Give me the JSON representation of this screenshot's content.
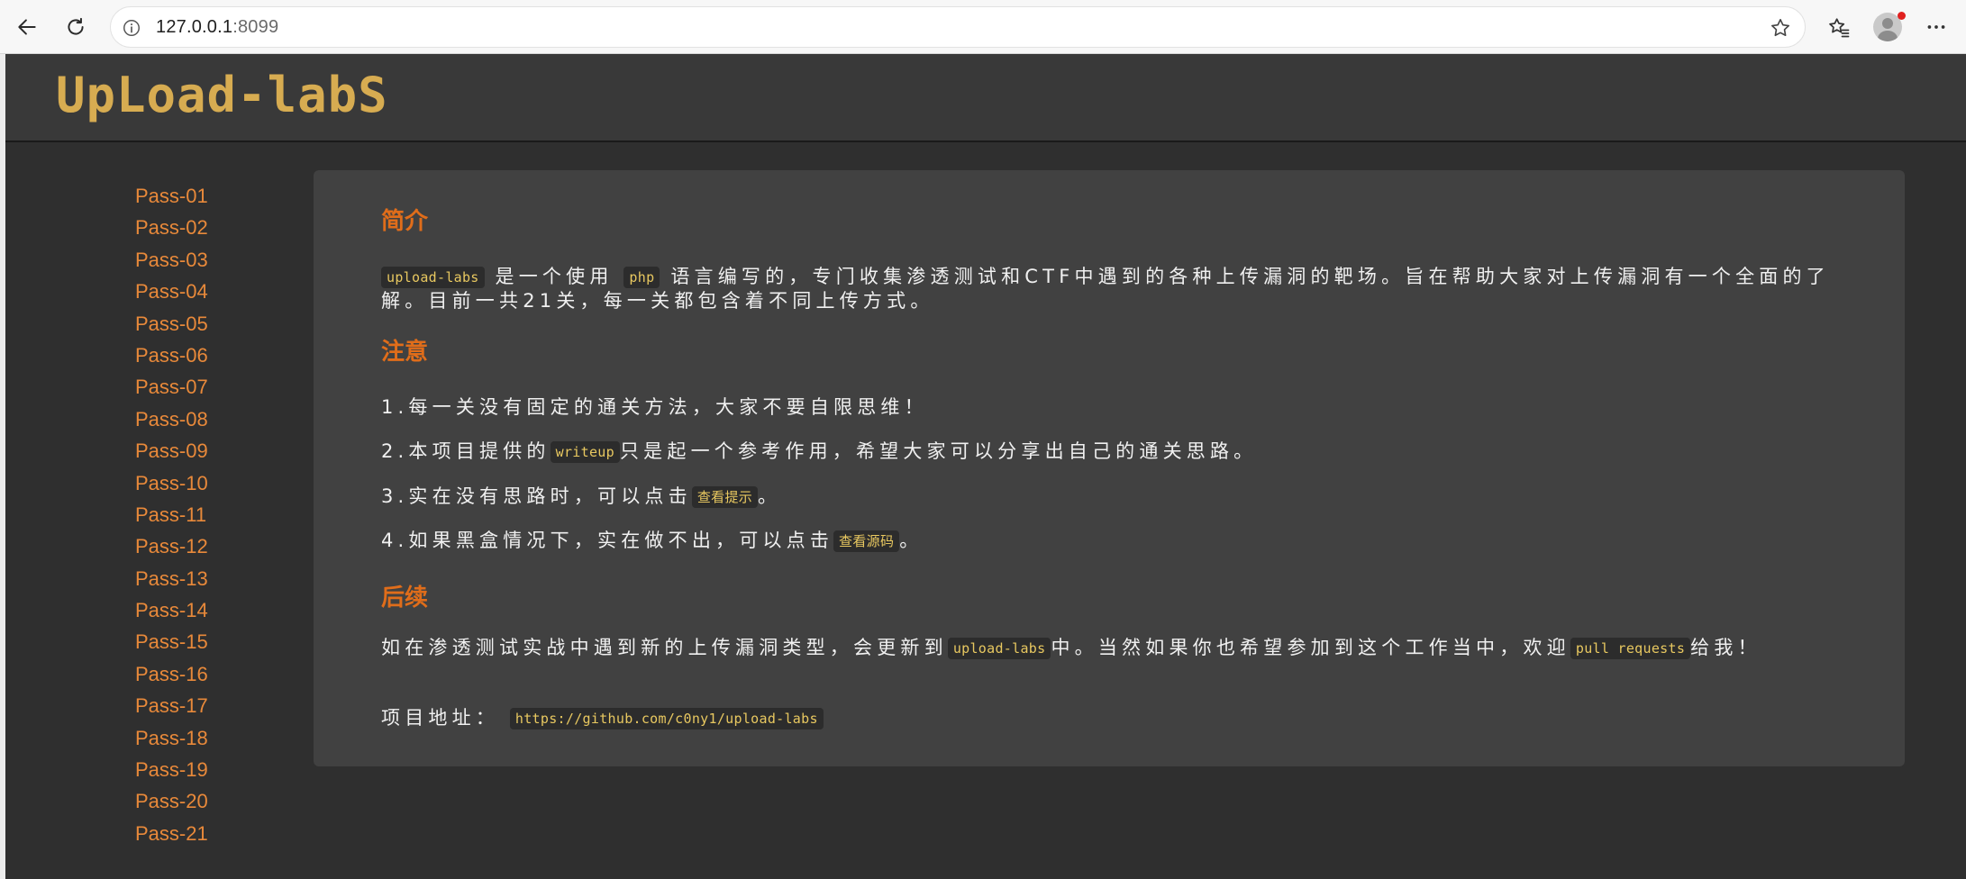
{
  "browser": {
    "url_host": "127.0.0.1",
    "url_port": ":8099",
    "icons": [
      "back-arrow-icon",
      "refresh-icon",
      "site-info-icon",
      "star-icon",
      "favorites-icon",
      "profile-avatar-icon",
      "more-icon"
    ],
    "notification_color": "#e0211f"
  },
  "header": {
    "logo_text": "UpLoad-labS",
    "logo_color": "#d7ac51"
  },
  "sidebar": {
    "link_color": "#e8893a",
    "items": [
      {
        "label": "Pass-01"
      },
      {
        "label": "Pass-02"
      },
      {
        "label": "Pass-03"
      },
      {
        "label": "Pass-04"
      },
      {
        "label": "Pass-05"
      },
      {
        "label": "Pass-06"
      },
      {
        "label": "Pass-07"
      },
      {
        "label": "Pass-08"
      },
      {
        "label": "Pass-09"
      },
      {
        "label": "Pass-10"
      },
      {
        "label": "Pass-11"
      },
      {
        "label": "Pass-12"
      },
      {
        "label": "Pass-13"
      },
      {
        "label": "Pass-14"
      },
      {
        "label": "Pass-15"
      },
      {
        "label": "Pass-16"
      },
      {
        "label": "Pass-17"
      },
      {
        "label": "Pass-18"
      },
      {
        "label": "Pass-19"
      },
      {
        "label": "Pass-20"
      },
      {
        "label": "Pass-21"
      }
    ]
  },
  "main": {
    "title_color": "#e06d1a",
    "intro": {
      "title": "简介",
      "code_project": "upload-labs",
      "text_1": "是一个使用",
      "code_php": "php",
      "text_2": "语言编写的，专门收集渗透测试和CTF中遇到的各种上传漏洞的靶场。旨在帮助大家对上传漏洞有一个全面的了解。目前一共21关，每一关都包含着不同上传方式。"
    },
    "notes": {
      "title": "注意",
      "item1": "1.每一关没有固定的通关方法，大家不要自限思维！",
      "item2_a": "2.本项目提供的",
      "item2_code": "writeup",
      "item2_b": "只是起一个参考作用，希望大家可以分享出自己的通关思路。",
      "item3_a": "3.实在没有思路时，可以点击",
      "item3_code": "查看提示",
      "item3_b": "。",
      "item4_a": "4.如果黑盒情况下，实在做不出，可以点击",
      "item4_code": "查看源码",
      "item4_b": "。"
    },
    "followup": {
      "title": "后续",
      "text_a": "如在渗透测试实战中遇到新的上传漏洞类型，会更新到",
      "code_project": "upload-labs",
      "text_b": "中。当然如果你也希望参加到这个工作当中，欢迎",
      "code_pr": "pull requests",
      "text_c": "给我！",
      "address_label": "项目地址：",
      "address_url": "https://github.com/c0ny1/upload-labs"
    }
  }
}
